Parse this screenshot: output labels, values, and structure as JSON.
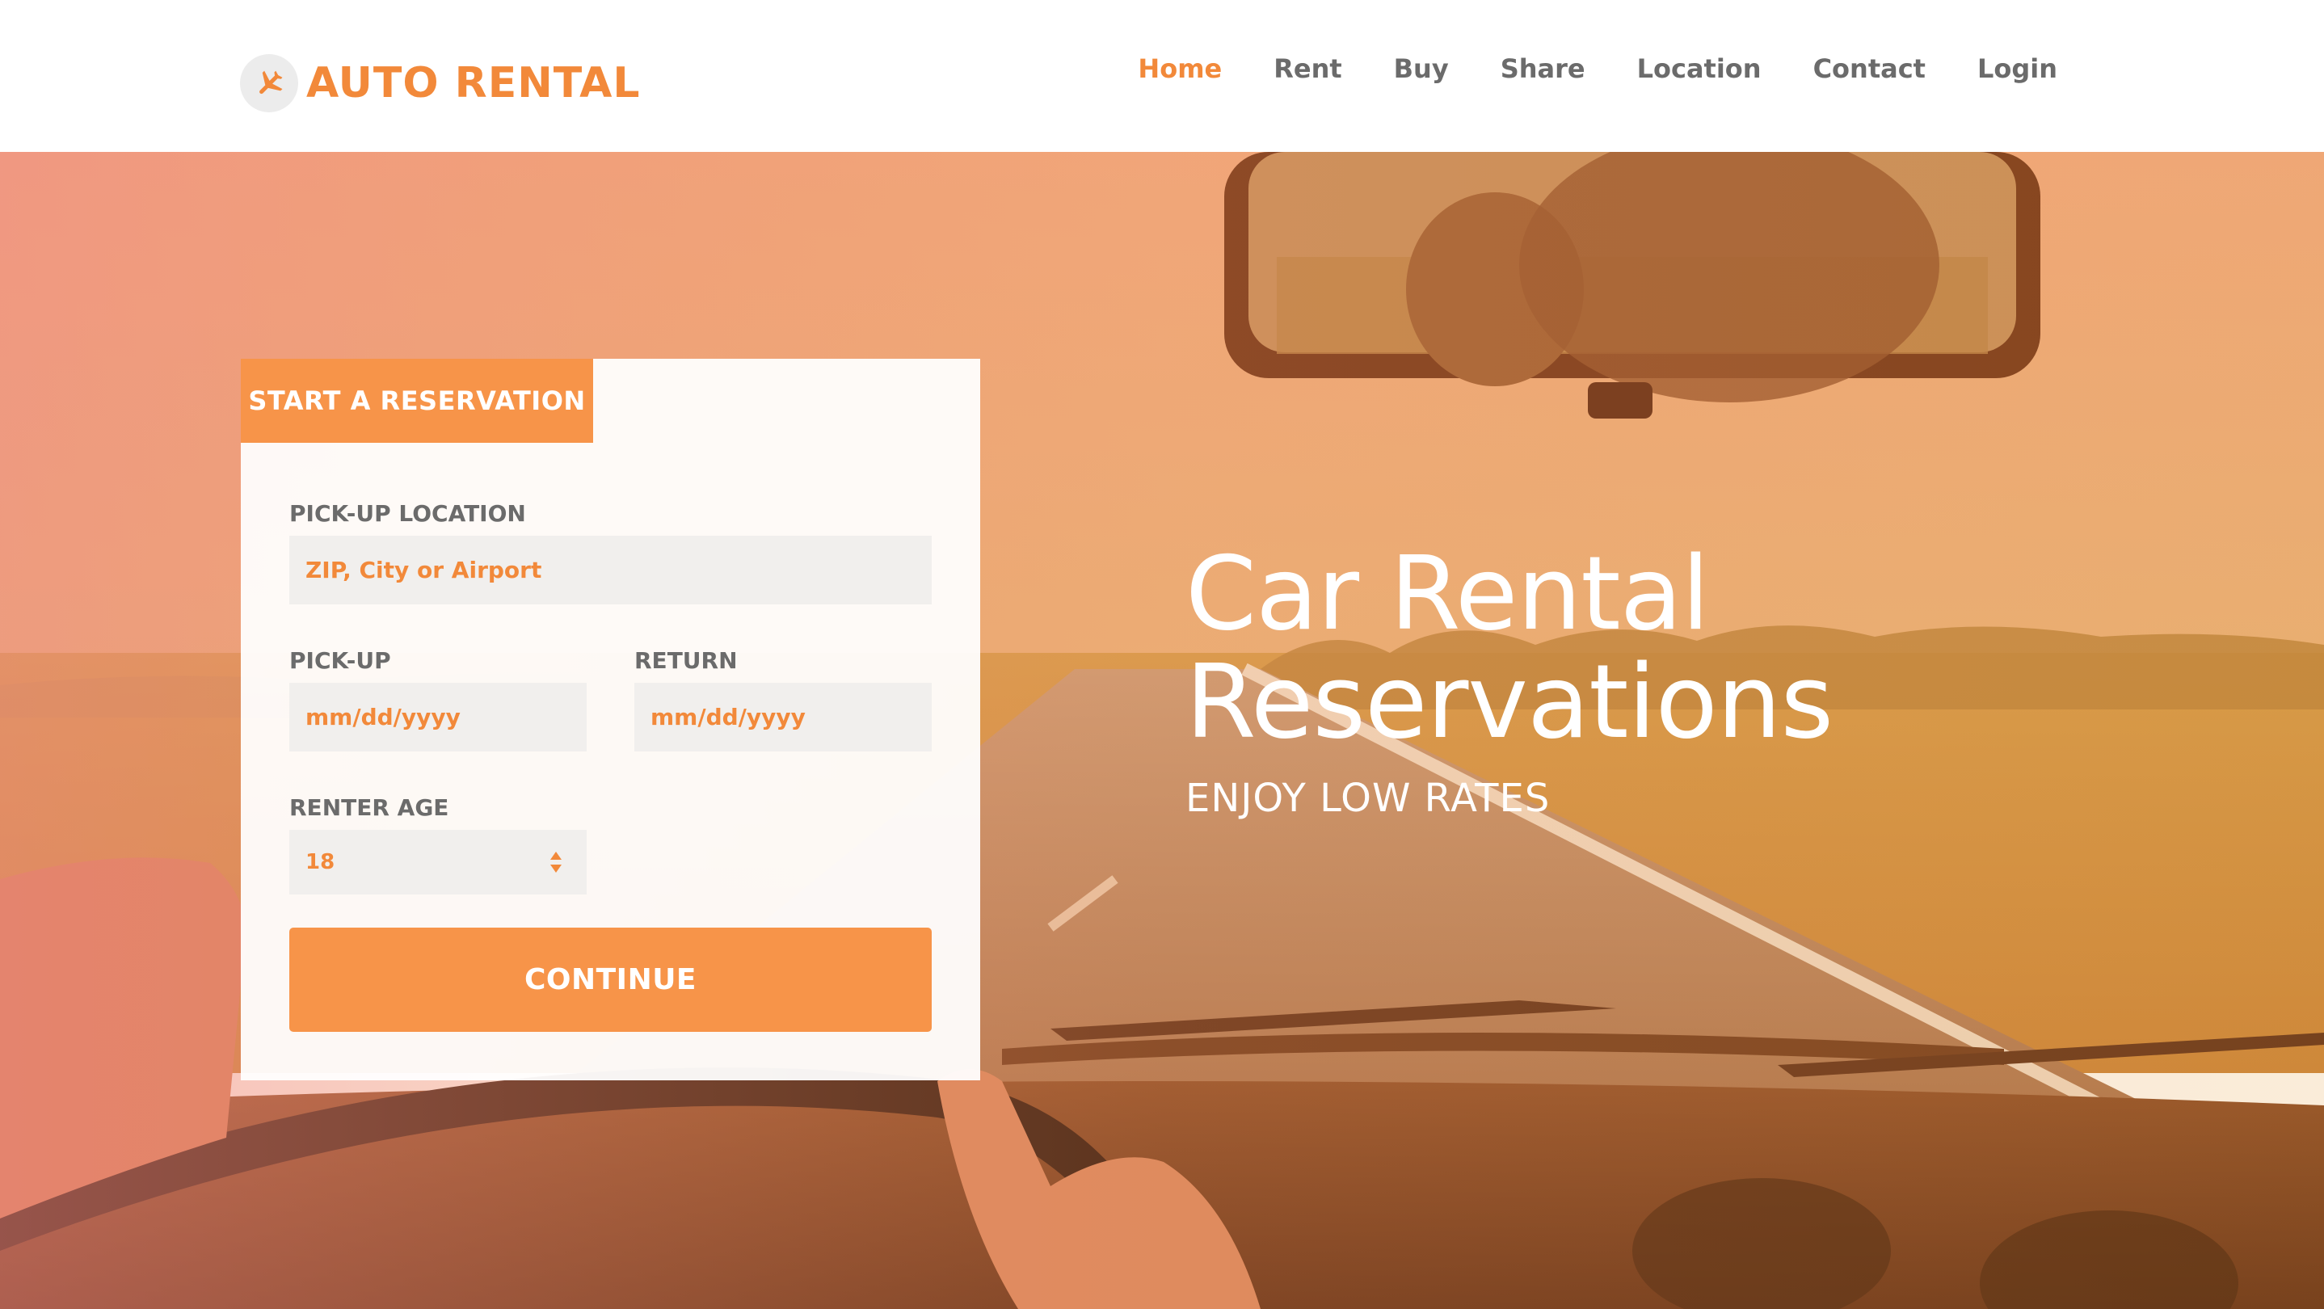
{
  "brand": {
    "name": "AUTO RENTAL",
    "icon": "airplane-icon",
    "color": "#f2893a"
  },
  "nav": {
    "items": [
      {
        "label": "Home",
        "active": true
      },
      {
        "label": "Rent"
      },
      {
        "label": "Buy"
      },
      {
        "label": "Share"
      },
      {
        "label": "Location"
      },
      {
        "label": "Contact"
      },
      {
        "label": "Login"
      }
    ]
  },
  "hero": {
    "title_line1": "Car Rental",
    "title_line2": "Reservations",
    "subtitle": "ENJOY LOW RATES"
  },
  "form": {
    "tab_label": "START A RESERVATION",
    "pickup_location_label": "PICK-UP LOCATION",
    "pickup_location_placeholder": "ZIP, City or Airport",
    "pickup_label": "PICK-UP",
    "pickup_value": "mm/dd/yyyy",
    "return_label": "RETURN",
    "return_value": "mm/dd/yyyy",
    "age_label": "RENTER AGE",
    "age_value": "18",
    "submit_label": "CONTINUE"
  },
  "colors": {
    "accent": "#f79449",
    "field_bg": "#f1efed",
    "label": "#6b6b6b"
  }
}
